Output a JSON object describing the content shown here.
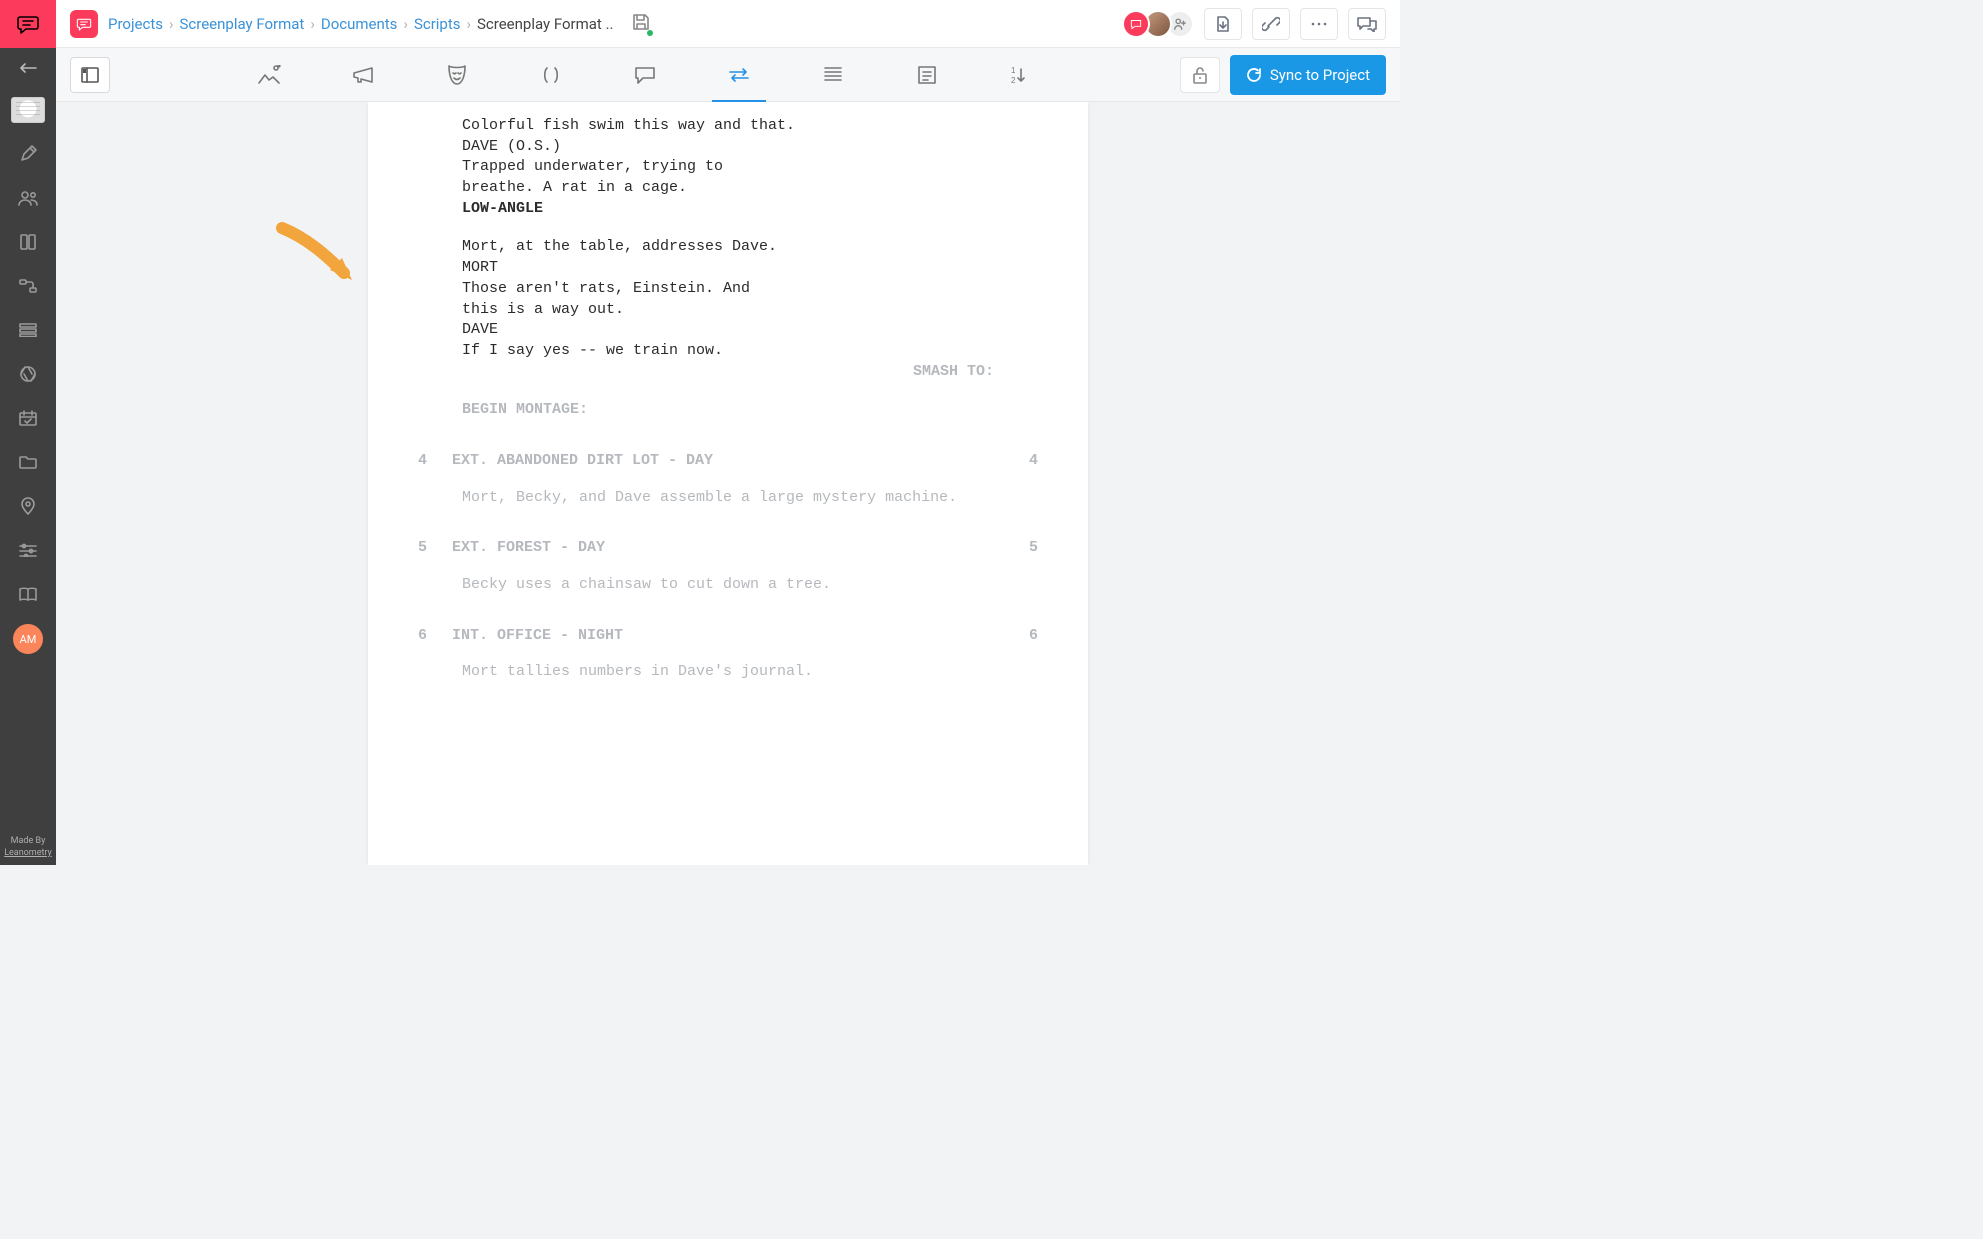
{
  "rail": {
    "avatar_initials": "AM",
    "made_by": "Made By",
    "made_by_link": "Leanometry"
  },
  "header": {
    "crumbs": [
      "Projects",
      "Screenplay Format",
      "Documents",
      "Scripts"
    ],
    "current": "Screenplay Format .."
  },
  "toolbar": {
    "sync_label": "Sync to Project"
  },
  "script": {
    "action1": "Colorful fish swim this way and that.",
    "char1": "DAVE (O.S.)",
    "dialog1a": "Trapped underwater, trying to",
    "dialog1b": "breathe. A rat in a cage.",
    "subheader": "LOW-ANGLE",
    "action2": "Mort, at the table, addresses Dave.",
    "char2": "MORT",
    "dialog2a": "Those aren't rats, Einstein. And",
    "dialog2b": "this is a way out.",
    "char3": "DAVE",
    "dialog3": "If I say yes -- we train now.",
    "transition": "SMASH TO:",
    "montage": "BEGIN MONTAGE:",
    "scenes": [
      {
        "num": "4",
        "heading": "EXT. ABANDONED DIRT LOT - DAY",
        "action": "Mort, Becky, and Dave assemble a large mystery machine."
      },
      {
        "num": "5",
        "heading": "EXT. FOREST - DAY",
        "action": "Becky uses a chainsaw to cut down a tree."
      },
      {
        "num": "6",
        "heading": "INT. OFFICE - NIGHT",
        "action": "Mort tallies numbers in Dave's journal."
      }
    ]
  }
}
